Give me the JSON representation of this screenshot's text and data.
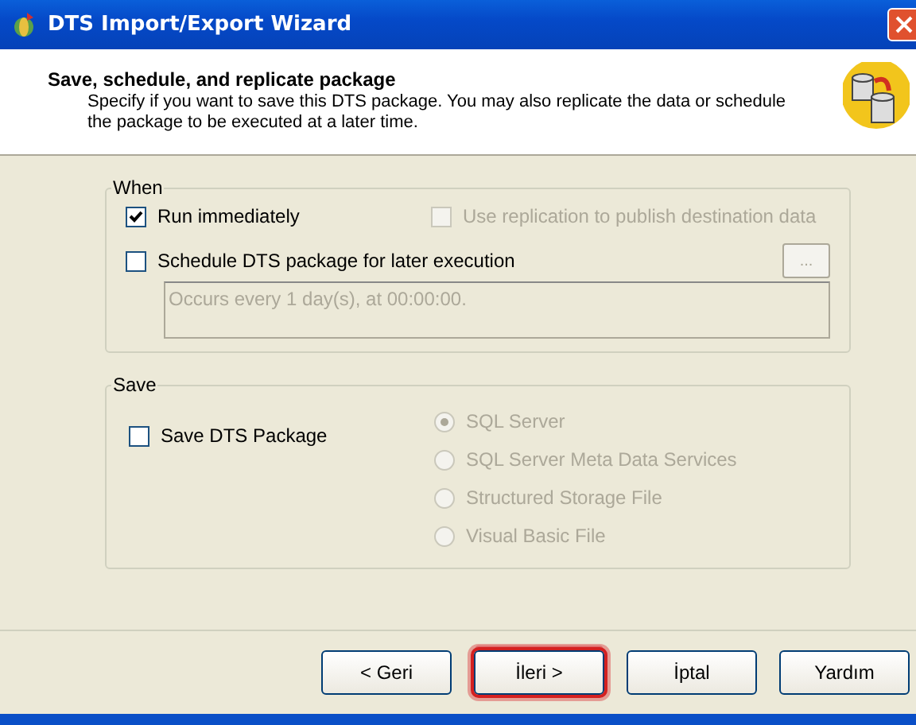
{
  "window": {
    "title": "DTS Import/Export Wizard"
  },
  "header": {
    "title": "Save, schedule, and replicate package",
    "description": "Specify if you want to save this DTS package.  You may also replicate the data or schedule the package to be executed at a later time."
  },
  "when": {
    "legend": "When",
    "run_immediately": {
      "label": "Run immediately",
      "checked": true,
      "disabled": false
    },
    "replication": {
      "label": "Use replication to publish destination data",
      "checked": false,
      "disabled": true
    },
    "schedule": {
      "label": "Schedule DTS package for later execution",
      "checked": false,
      "disabled": false
    },
    "browse_button": "...",
    "schedule_text": "Occurs every 1 day(s), at 00:00:00."
  },
  "save": {
    "legend": "Save",
    "save_package": {
      "label": "Save DTS Package",
      "checked": false,
      "disabled": false
    },
    "options": [
      {
        "label": "SQL Server",
        "selected": true,
        "disabled": true
      },
      {
        "label": "SQL Server Meta Data Services",
        "selected": false,
        "disabled": true
      },
      {
        "label": "Structured Storage File",
        "selected": false,
        "disabled": true
      },
      {
        "label": "Visual Basic File",
        "selected": false,
        "disabled": true
      }
    ]
  },
  "buttons": [
    {
      "label": "< Geri",
      "highlighted": false
    },
    {
      "label": "İleri >",
      "highlighted": true
    },
    {
      "label": "İptal",
      "highlighted": false
    },
    {
      "label": "Yardım",
      "highlighted": false
    }
  ]
}
